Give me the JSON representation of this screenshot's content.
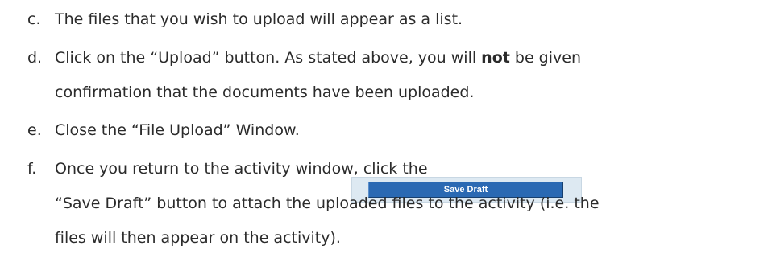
{
  "items": [
    {
      "marker": "c.",
      "lines": [
        "The files that you wish to upload will appear as a list."
      ]
    },
    {
      "marker": "d.",
      "line1_pre": "Click on the “Upload” button. As stated above, you will ",
      "line1_bold": "not",
      "line1_post": " be given",
      "line2": "confirmation that the documents have been uploaded."
    },
    {
      "marker": "e.",
      "lines": [
        "Close the “File Upload” Window."
      ]
    },
    {
      "marker": "f.",
      "line1": "Once you return to the activity window, click the",
      "line2": "“Save Draft” button to attach the uploaded files to the activity (i.e. the",
      "line3": "files will then appear on the activity)."
    }
  ],
  "save_draft_button_label": "Save Draft"
}
